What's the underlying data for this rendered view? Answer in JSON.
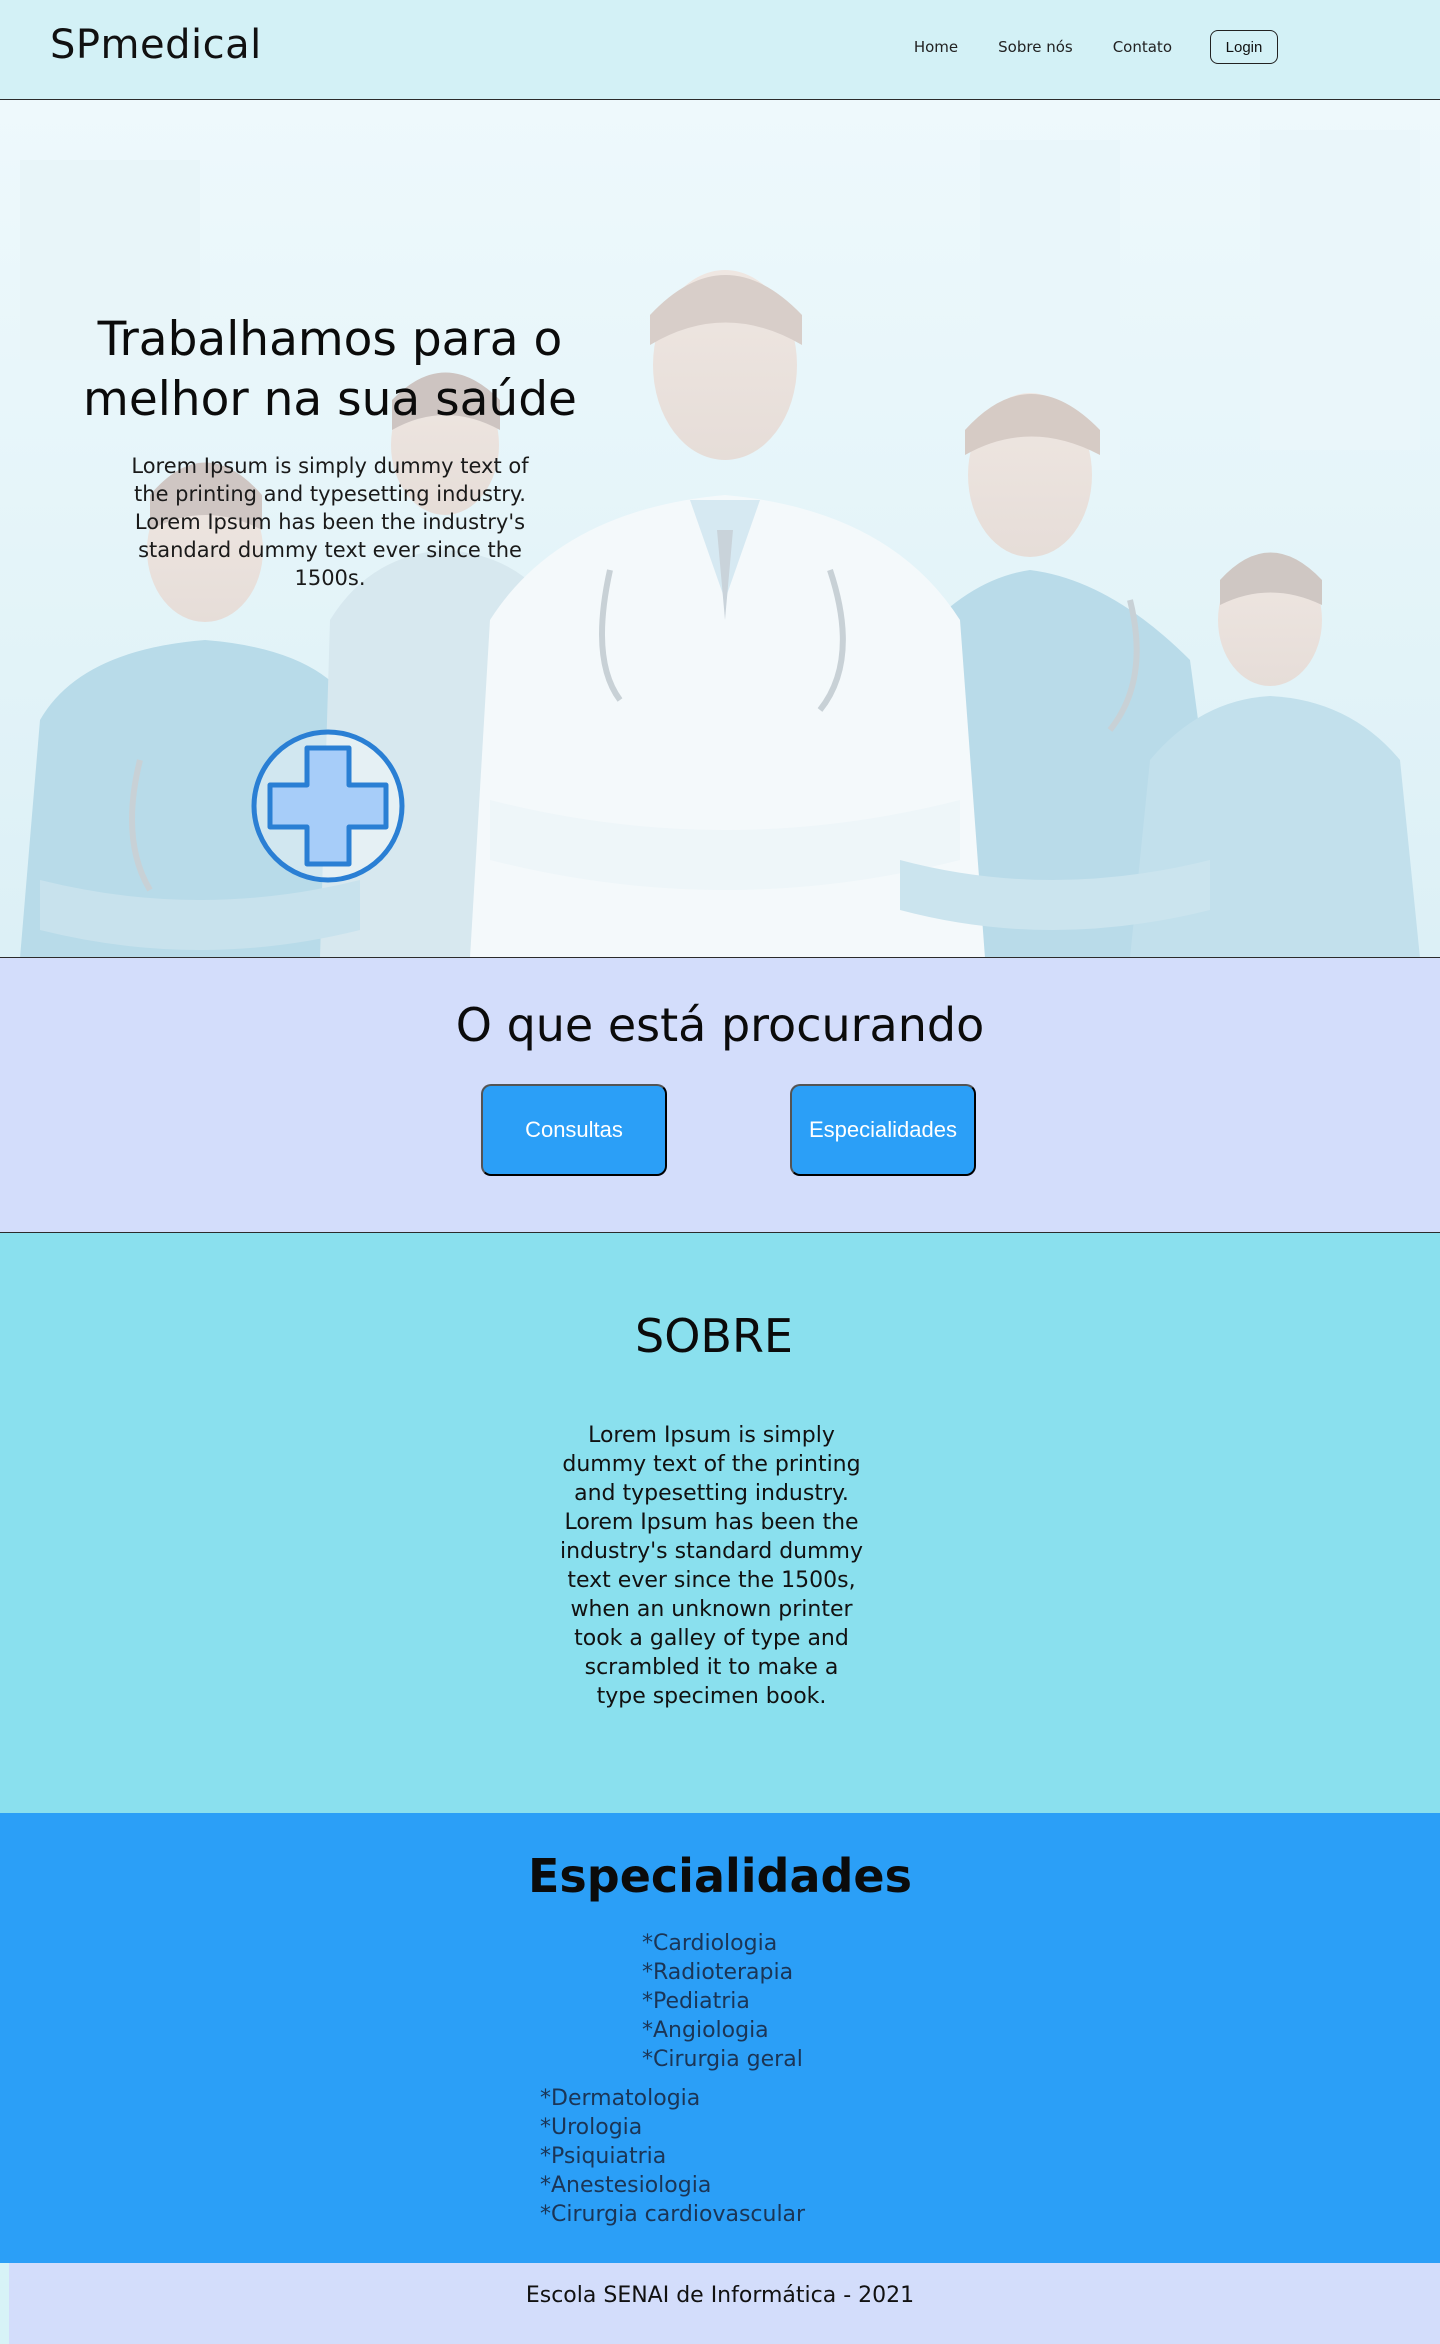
{
  "header": {
    "brand": "SPmedical",
    "nav": [
      "Home",
      "Sobre nós",
      "Contato"
    ],
    "login_label": "Login"
  },
  "hero": {
    "title": "Trabalhamos para o melhor na sua saúde",
    "text": "Lorem Ipsum is simply dummy text of the printing and typesetting industry. Lorem Ipsum has been the industry's standard dummy text ever since the 1500s.",
    "icon": "medical-cross-icon"
  },
  "search": {
    "title": "O que está procurando",
    "buttons": [
      "Consultas",
      "Especialidades"
    ]
  },
  "about": {
    "title": "SOBRE",
    "text": "Lorem Ipsum is simply dummy text of the printing and typesetting industry. Lorem Ipsum has been the industry's standard dummy text ever since the 1500s, when an unknown printer took a galley of type and scrambled it to make a type specimen book."
  },
  "specialties": {
    "title": "Especialidades",
    "list_a": [
      "*Cardiologia",
      "*Radioterapia",
      "*Pediatria",
      "*Angiologia",
      "*Cirurgia geral"
    ],
    "list_b": [
      "*Dermatologia",
      "*Urologia",
      "*Psiquiatria",
      "*Anestesiologia",
      "*Cirurgia cardiovascular"
    ]
  },
  "footer": {
    "text": "Escola SENAI de Informática - 2021"
  },
  "colors": {
    "header_bg": "#d3f1f6",
    "section_lavender": "#d3ddfb",
    "section_cyan": "#8ae0ee",
    "accent_blue": "#2b9ff7",
    "cross_fill": "#a7cdf9",
    "cross_stroke": "#2a7fd4"
  }
}
